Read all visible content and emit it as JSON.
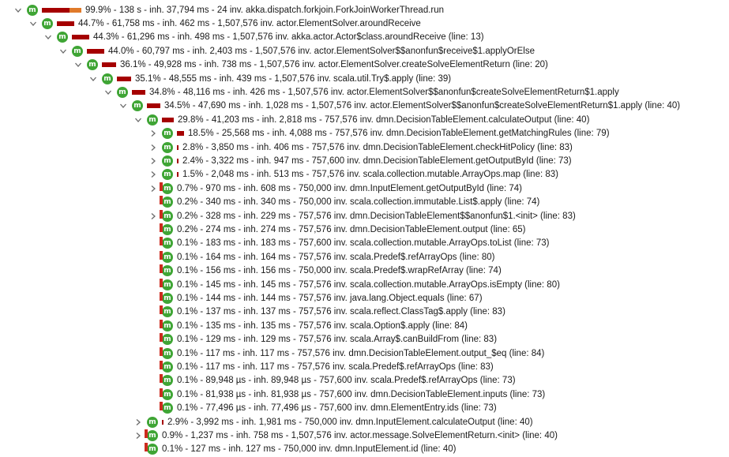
{
  "colors": {
    "icon": "#3fa535",
    "bar": "#a50000",
    "bar_light": "#e07a2a",
    "chevron": "#6b6b6b"
  },
  "rows": [
    {
      "text": "99.9% - 138 s - inh. 37,794 ms - 24 inv. akka.dispatch.forkjoin.ForkJoinWorkerThread.run",
      "pct": 99.9,
      "expanded": true
    },
    {
      "text": "44.7% - 61,758 ms - inh. 462 ms - 1,507,576 inv. actor.ElementSolver.aroundReceive",
      "pct": 44.7,
      "expanded": true
    },
    {
      "text": "44.3% - 61,296 ms - inh. 498 ms - 1,507,576 inv. akka.actor.Actor$class.aroundReceive (line: 13)",
      "pct": 44.3,
      "expanded": true
    },
    {
      "text": "44.0% - 60,797 ms - inh. 2,403 ms - 1,507,576 inv. actor.ElementSolver$$anonfun$receive$1.applyOrElse",
      "pct": 44.0,
      "expanded": true
    },
    {
      "text": "36.1% - 49,928 ms - inh. 738 ms - 1,507,576 inv. actor.ElementSolver.createSolveElementReturn (line: 20)",
      "pct": 36.1,
      "expanded": true
    },
    {
      "text": "35.1% - 48,555 ms - inh. 439 ms - 1,507,576 inv. scala.util.Try$.apply (line: 39)",
      "pct": 35.1,
      "expanded": true
    },
    {
      "text": "34.8% - 48,116 ms - inh. 426 ms - 1,507,576 inv. actor.ElementSolver$$anonfun$createSolveElementReturn$1.apply",
      "pct": 34.8,
      "expanded": true
    },
    {
      "text": "34.5% - 47,690 ms - inh. 1,028 ms - 1,507,576 inv. actor.ElementSolver$$anonfun$createSolveElementReturn$1.apply (line: 40)",
      "pct": 34.5,
      "expanded": true
    },
    {
      "text": "29.8% - 41,203 ms - inh. 2,818 ms - 757,576 inv. dmn.DecisionTableElement.calculateOutput (line: 40)",
      "pct": 29.8,
      "expanded": true
    },
    {
      "text": "18.5% - 25,568 ms - inh. 4,088 ms - 757,576 inv. dmn.DecisionTableElement.getMatchingRules (line: 79)",
      "pct": 18.5,
      "expanded": false
    },
    {
      "text": "2.8% - 3,850 ms - inh. 406 ms - 757,576 inv. dmn.DecisionTableElement.checkHitPolicy (line: 83)",
      "pct": 2.8,
      "expanded": false
    },
    {
      "text": "2.4% - 3,322 ms - inh. 947 ms - 757,600 inv. dmn.DecisionTableElement.getOutputById (line: 73)",
      "pct": 2.4,
      "expanded": false
    },
    {
      "text": "1.5% - 2,048 ms - inh. 513 ms - 757,576 inv. scala.collection.mutable.ArrayOps.map (line: 83)",
      "pct": 1.5,
      "expanded": false
    },
    {
      "text": "0.7% - 970 ms - inh. 608 ms - 750,000 inv. dmn.InputElement.getOutputById (line: 74)",
      "pct": 0.7,
      "expanded": false
    },
    {
      "text": "0.2% - 340 ms - inh. 340 ms - 750,000 inv. scala.collection.immutable.List$.apply (line: 74)",
      "pct": 0.2,
      "expanded": null
    },
    {
      "text": "0.2% - 328 ms - inh. 229 ms - 757,576 inv. dmn.DecisionTableElement$$anonfun$1.<init> (line: 83)",
      "pct": 0.2,
      "expanded": false
    },
    {
      "text": "0.2% - 274 ms - inh. 274 ms - 757,576 inv. dmn.DecisionTableElement.output (line: 65)",
      "pct": 0.2,
      "expanded": null
    },
    {
      "text": "0.1% - 183 ms - inh. 183 ms - 757,600 inv. scala.collection.mutable.ArrayOps.toList (line: 73)",
      "pct": 0.1,
      "expanded": null
    },
    {
      "text": "0.1% - 164 ms - inh. 164 ms - 757,576 inv. scala.Predef$.refArrayOps (line: 80)",
      "pct": 0.1,
      "expanded": null
    },
    {
      "text": "0.1% - 156 ms - inh. 156 ms - 750,000 inv. scala.Predef$.wrapRefArray (line: 74)",
      "pct": 0.1,
      "expanded": null
    },
    {
      "text": "0.1% - 145 ms - inh. 145 ms - 757,576 inv. scala.collection.mutable.ArrayOps.isEmpty (line: 80)",
      "pct": 0.1,
      "expanded": null
    },
    {
      "text": "0.1% - 144 ms - inh. 144 ms - 757,576 inv. java.lang.Object.equals (line: 67)",
      "pct": 0.1,
      "expanded": null
    },
    {
      "text": "0.1% - 137 ms - inh. 137 ms - 757,576 inv. scala.reflect.ClassTag$.apply (line: 83)",
      "pct": 0.1,
      "expanded": null
    },
    {
      "text": "0.1% - 135 ms - inh. 135 ms - 757,576 inv. scala.Option$.apply (line: 84)",
      "pct": 0.1,
      "expanded": null
    },
    {
      "text": "0.1% - 129 ms - inh. 129 ms - 757,576 inv. scala.Array$.canBuildFrom (line: 83)",
      "pct": 0.1,
      "expanded": null
    },
    {
      "text": "0.1% - 117 ms - inh. 117 ms - 757,576 inv. dmn.DecisionTableElement.output_$eq (line: 84)",
      "pct": 0.1,
      "expanded": null
    },
    {
      "text": "0.1% - 117 ms - inh. 117 ms - 757,576 inv. scala.Predef$.refArrayOps (line: 83)",
      "pct": 0.1,
      "expanded": null
    },
    {
      "text": "0.1% - 89,948 µs - inh. 89,948 µs - 757,600 inv. scala.Predef$.refArrayOps (line: 73)",
      "pct": 0.1,
      "expanded": null
    },
    {
      "text": "0.1% - 81,938 µs - inh. 81,938 µs - 757,600 inv. dmn.DecisionTableElement.inputs (line: 73)",
      "pct": 0.1,
      "expanded": null
    },
    {
      "text": "0.1% - 77,496 µs - inh. 77,496 µs - 757,600 inv. dmn.ElementEntry.ids (line: 73)",
      "pct": 0.1,
      "expanded": null
    },
    {
      "text": "2.9% - 3,992 ms - inh. 1,981 ms - 750,000 inv. dmn.InputElement.calculateOutput (line: 40)",
      "pct": 2.9,
      "expanded": false
    },
    {
      "text": "0.9% - 1,237 ms - inh. 758 ms - 1,507,576 inv. actor.message.SolveElementReturn.<init> (line: 40)",
      "pct": 0.9,
      "expanded": false
    },
    {
      "text": "0.1% - 127 ms - inh. 127 ms - 750,000 inv. dmn.InputElement.id (line: 40)",
      "pct": 0.1,
      "expanded": null
    }
  ]
}
